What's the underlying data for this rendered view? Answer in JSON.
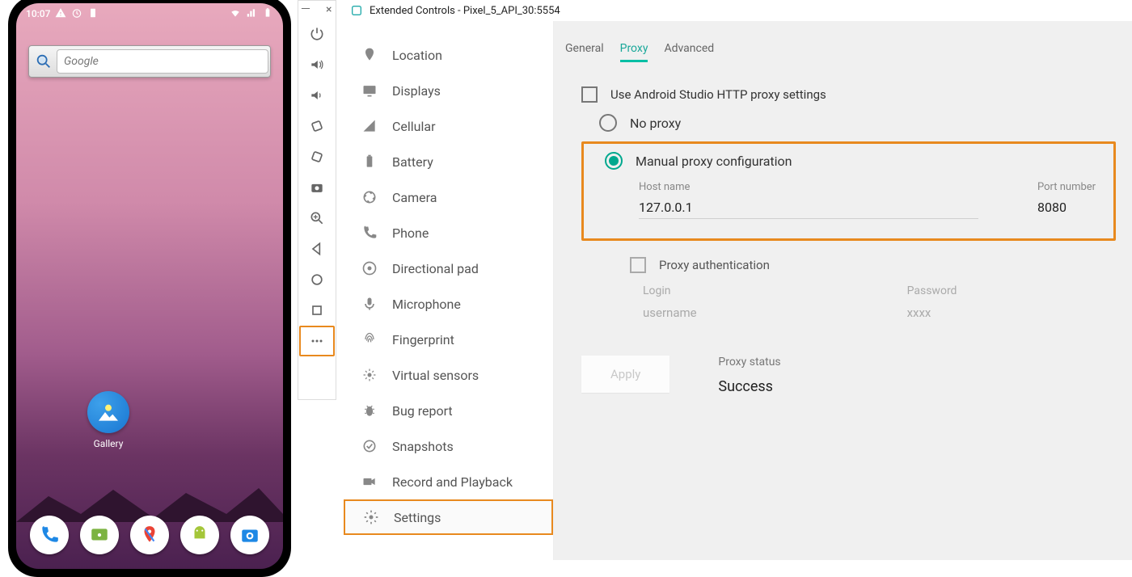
{
  "phone": {
    "statusbar_time": "10:07",
    "status_icons": [
      "warning",
      "clock",
      "battery"
    ],
    "status_right_icons": [
      "wifi",
      "signal",
      "battery-full"
    ],
    "search_placeholder": "Google",
    "gallery_label": "Gallery",
    "dock_apps": [
      "phone",
      "messages",
      "maps",
      "android",
      "camera"
    ]
  },
  "emu_toolbar": {
    "buttons": [
      "power",
      "volume-up",
      "volume-down",
      "rotate-left",
      "rotate-right",
      "camera",
      "zoom",
      "back",
      "home",
      "recents",
      "more"
    ]
  },
  "ext": {
    "title": "Extended Controls  -  Pixel_5_API_30:5554",
    "sidebar": [
      {
        "icon": "location",
        "label": "Location"
      },
      {
        "icon": "displays",
        "label": "Displays"
      },
      {
        "icon": "cellular",
        "label": "Cellular"
      },
      {
        "icon": "battery",
        "label": "Battery"
      },
      {
        "icon": "camera",
        "label": "Camera"
      },
      {
        "icon": "phone",
        "label": "Phone"
      },
      {
        "icon": "dpad",
        "label": "Directional pad"
      },
      {
        "icon": "mic",
        "label": "Microphone"
      },
      {
        "icon": "finger",
        "label": "Fingerprint"
      },
      {
        "icon": "sensors",
        "label": "Virtual sensors"
      },
      {
        "icon": "bug",
        "label": "Bug report"
      },
      {
        "icon": "snapshot",
        "label": "Snapshots"
      },
      {
        "icon": "record",
        "label": "Record and Playback"
      },
      {
        "icon": "settings",
        "label": "Settings"
      }
    ],
    "tabs": {
      "general": "General",
      "proxy": "Proxy",
      "advanced": "Advanced"
    },
    "form": {
      "use_as_http": "Use Android Studio HTTP proxy settings",
      "no_proxy": "No proxy",
      "manual_proxy": "Manual proxy configuration",
      "host_label": "Host name",
      "host_value": "127.0.0.1",
      "port_label": "Port number",
      "port_value": "8080",
      "auth_label": "Proxy authentication",
      "login_label": "Login",
      "login_value": "username",
      "pw_label": "Password",
      "pw_value": "xxxx",
      "apply": "Apply",
      "status_label": "Proxy status",
      "status_value": "Success"
    }
  }
}
